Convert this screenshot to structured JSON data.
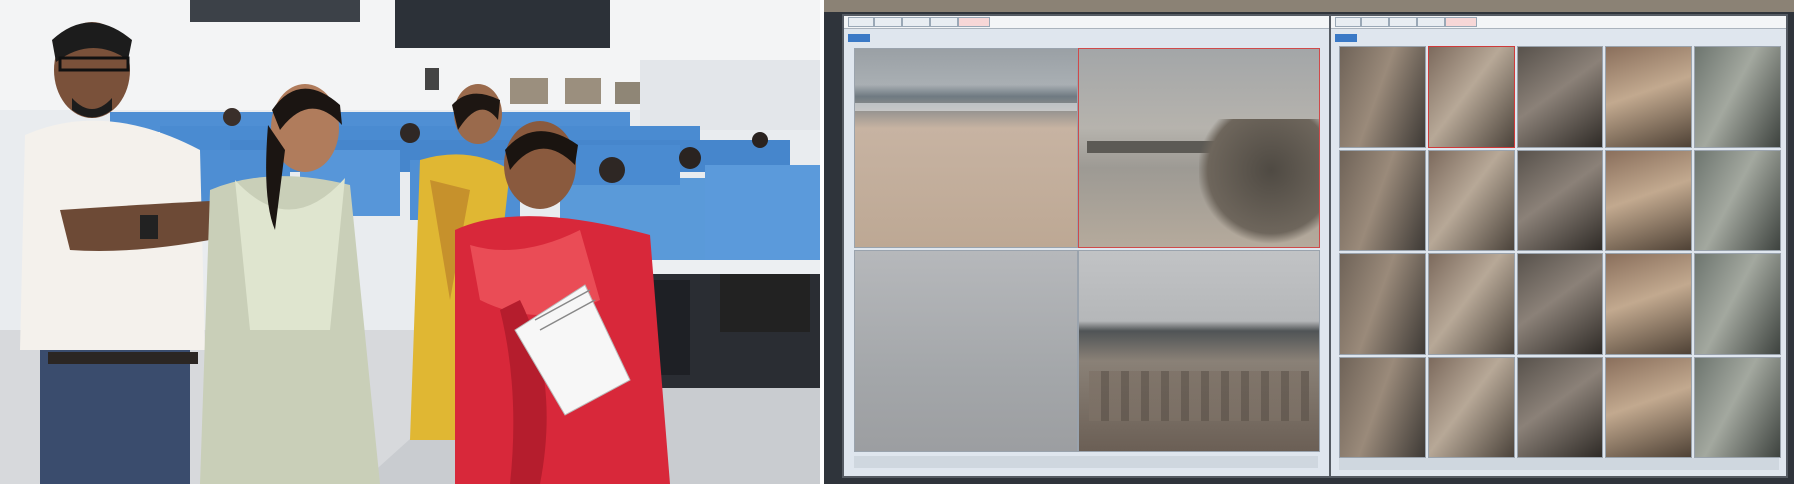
{
  "left_photo": {
    "people": [
      "man-in-white-shirt",
      "woman-in-green-kurta",
      "woman-in-yellow-dress",
      "woman-in-red-saree"
    ]
  },
  "left_monitor": {
    "feeds": [
      {
        "scene": "beach"
      },
      {
        "scene": "sea-wall"
      },
      {
        "scene": "foggy-sea"
      },
      {
        "scene": "harbour"
      }
    ]
  },
  "right_monitor": {
    "grid": {
      "rows": 4,
      "cols": 5
    }
  },
  "colors": {
    "monitor_frame": "#2f343b",
    "ui_background": "#dfe6ee",
    "tab_blue": "#3a79c6",
    "saree_red": "#d8283a",
    "desk_blue": "#4a8fd8"
  }
}
